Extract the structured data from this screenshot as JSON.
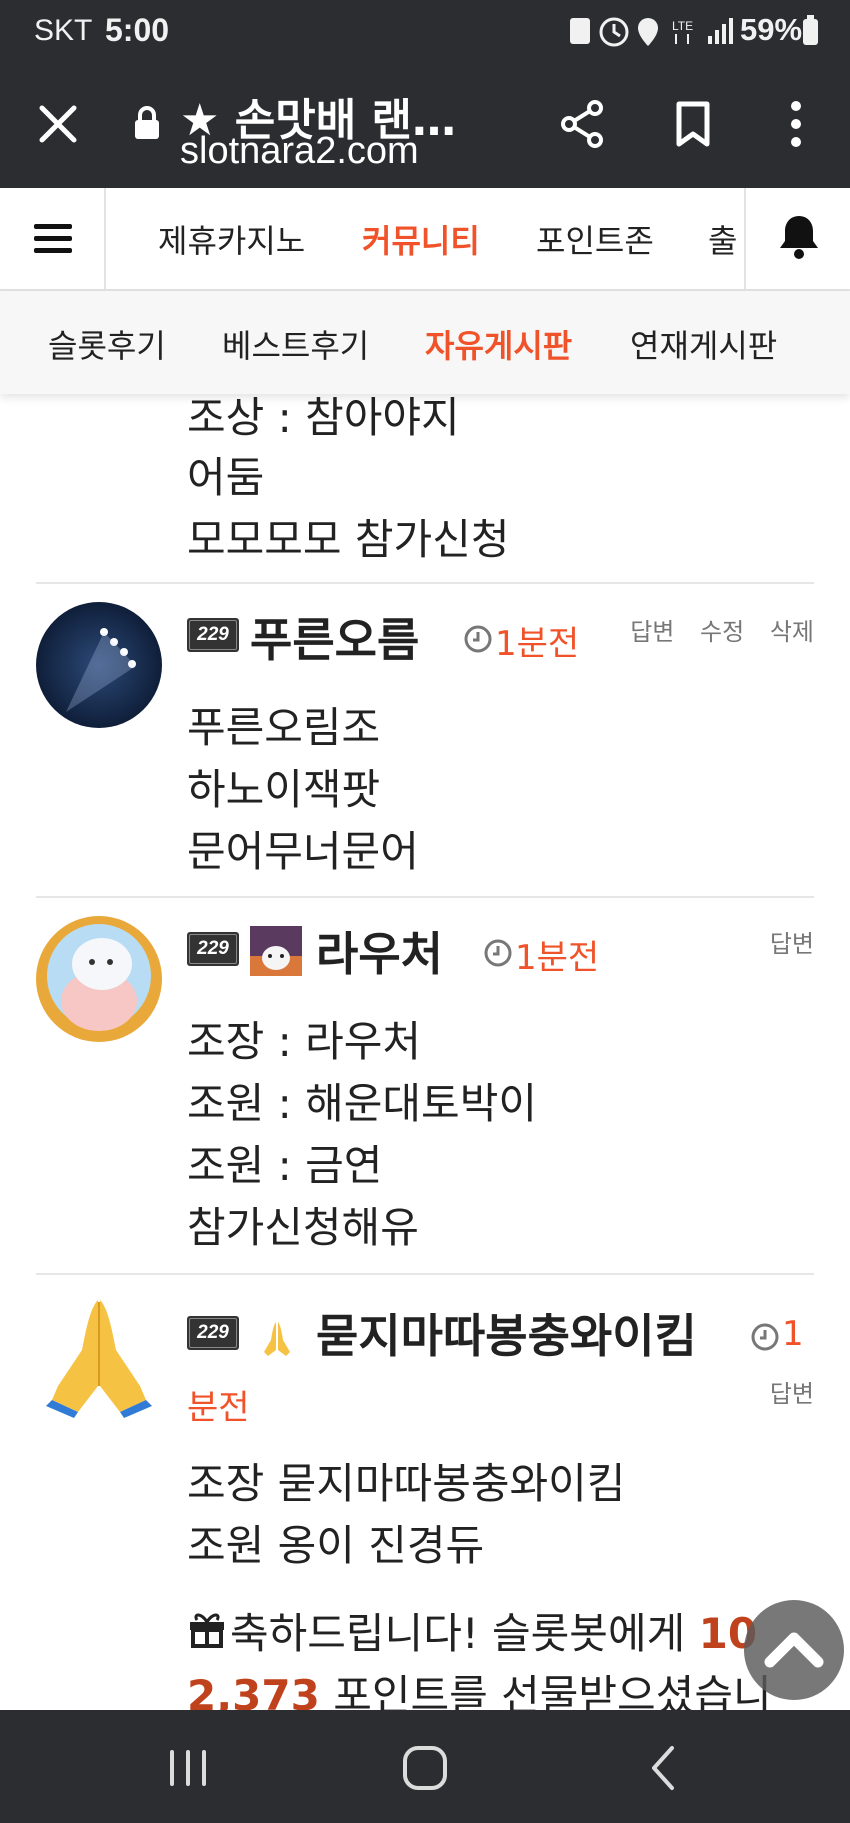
{
  "status_bar": {
    "carrier": "SKT",
    "time": "5:00",
    "battery": "59%"
  },
  "browser": {
    "title": "★ 손맛배 랜…",
    "url": "slotnara2.com"
  },
  "main_nav": {
    "tabs": [
      {
        "label": "제휴카지노",
        "active": false
      },
      {
        "label": "커뮤니티",
        "active": true
      },
      {
        "label": "포인트존",
        "active": false
      },
      {
        "label": "출",
        "active": false
      }
    ]
  },
  "sub_nav": {
    "tabs": [
      {
        "label": "슬롯후기",
        "active": false
      },
      {
        "label": "베스트후기",
        "active": false
      },
      {
        "label": "자유게시판",
        "active": true
      },
      {
        "label": "연재게시판",
        "active": false
      }
    ]
  },
  "comments": [
    {
      "lines": [
        "조상 : 참아야지",
        "어둠",
        "모모모모  참가신청"
      ]
    },
    {
      "level": "229",
      "nickname": "푸른오름",
      "time": "1분전",
      "actions": [
        "답변",
        "수정",
        "삭제"
      ],
      "lines": [
        "푸른오림조",
        "하노이잭팟",
        "문어무너문어"
      ]
    },
    {
      "level": "229",
      "nickname": "라우처",
      "time": "1분전",
      "actions": [
        "답변"
      ],
      "lines": [
        "조장 : 라우처",
        "조원 : 해운대토박이",
        "조원 : 금연",
        "참가신청해유"
      ]
    },
    {
      "level": "229",
      "nickname": "묻지마따봉충와이킴",
      "time_part1": "1",
      "time_part2": "분전",
      "actions": [
        "답변"
      ],
      "lines": [
        "조장 묻지마따봉충와이킴",
        "조원 옹이 진경듀"
      ],
      "gift_prefix": "축하드립니다! 슬롯봇에게 ",
      "gift_amount_1": "10",
      "gift_amount_2": "2,373",
      "gift_suffix": " 포인트를 선물받으셨습니"
    }
  ],
  "icons": {
    "accent_color": "#f0532a",
    "bar_color": "#2b2d31"
  }
}
